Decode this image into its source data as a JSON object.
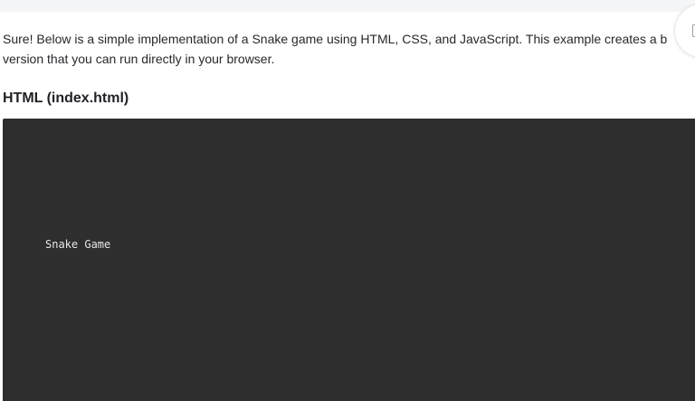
{
  "message": {
    "intro_line_1": "Sure! Below is a simple implementation of a Snake game using HTML, CSS, and JavaScript. This example creates a b",
    "intro_line_2": "version that you can run directly in your browser."
  },
  "section": {
    "heading": "HTML (index.html)"
  },
  "code": {
    "visible_text": "Snake Game",
    "background_color": "#2e2e2e",
    "text_color": "#e6e6e6"
  },
  "side_control": {
    "icon": "panel-icon"
  }
}
